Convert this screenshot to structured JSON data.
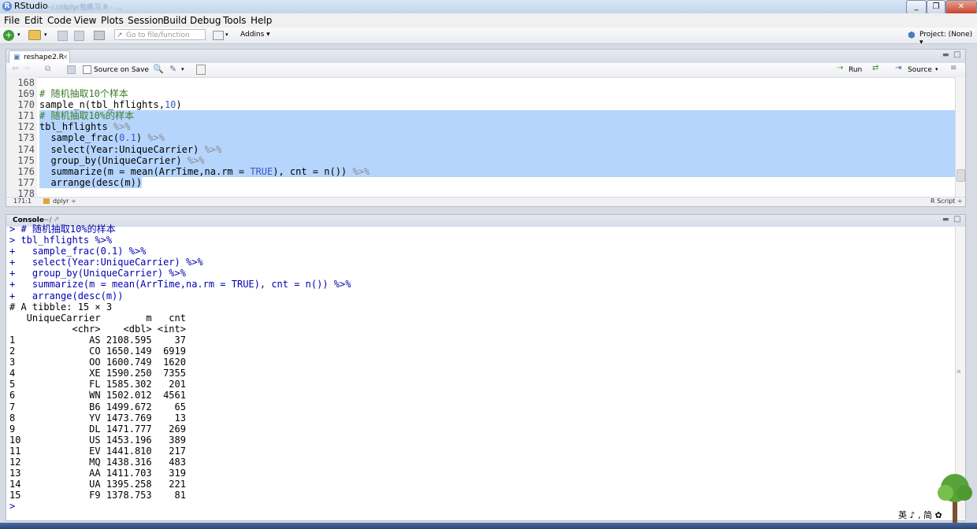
{
  "window": {
    "title": "RStudio",
    "title_blurred": "~/.r/dplyr包练习.R - ..."
  },
  "menu": [
    "File",
    "Edit",
    "Code",
    "View",
    "Plots",
    "Session",
    "Build",
    "Debug",
    "Tools",
    "Help"
  ],
  "toolbar": {
    "goto_placeholder": "Go to file/function",
    "addins_label": "Addins ▾",
    "project_label": "Project: (None) ▾"
  },
  "editor": {
    "tab_label": "reshape2.R",
    "source_on_save": "Source on Save",
    "run_label": "Run",
    "source_label": "Source",
    "line_numbers": [
      "168",
      "169",
      "170",
      "171",
      "172",
      "173",
      "174",
      "175",
      "176",
      "177",
      "178"
    ],
    "cursor_pos": "171:1",
    "scope": "dplyr ÷",
    "filetype": "R Script ÷",
    "lines": [
      {
        "parts": [
          {
            "t": ""
          }
        ]
      },
      {
        "parts": [
          {
            "t": "# 随机抽取10个样本",
            "c": "cm"
          }
        ]
      },
      {
        "parts": [
          {
            "t": "sample_n(tbl_hflights,"
          },
          {
            "t": "10",
            "c": "nm"
          },
          {
            "t": ")"
          }
        ]
      },
      {
        "parts": [
          {
            "t": "# 随机抽取10%的样本",
            "c": "cm"
          }
        ],
        "sel": true
      },
      {
        "parts": [
          {
            "t": "tbl_hflights "
          },
          {
            "t": "%>%",
            "c": "sp"
          }
        ],
        "sel": true
      },
      {
        "parts": [
          {
            "t": "  sample_frac("
          },
          {
            "t": "0.1",
            "c": "nm"
          },
          {
            "t": ") "
          },
          {
            "t": "%>%",
            "c": "sp"
          }
        ],
        "sel": true
      },
      {
        "parts": [
          {
            "t": "  select(Year:UniqueCarrier) "
          },
          {
            "t": "%>%",
            "c": "sp"
          }
        ],
        "sel": true
      },
      {
        "parts": [
          {
            "t": "  group_by(UniqueCarrier) "
          },
          {
            "t": "%>%",
            "c": "sp"
          }
        ],
        "sel": true
      },
      {
        "parts": [
          {
            "t": "  summarize(m = mean(ArrTime,na.rm = "
          },
          {
            "t": "TRUE",
            "c": "bool"
          },
          {
            "t": "), cnt = n()) "
          },
          {
            "t": "%>%",
            "c": "sp"
          }
        ],
        "sel": true
      },
      {
        "parts": [
          {
            "t": "  arrange(desc(m))"
          }
        ],
        "sel": true,
        "partial": true
      },
      {
        "parts": [
          {
            "t": ""
          }
        ]
      }
    ]
  },
  "console": {
    "title": "Console",
    "path": "~/",
    "input_lines": [
      "> # 随机抽取10%的样本",
      "> tbl_hflights %>%",
      "+   sample_frac(0.1) %>%",
      "+   select(Year:UniqueCarrier) %>%",
      "+   group_by(UniqueCarrier) %>%",
      "+   summarize(m = mean(ArrTime,na.rm = TRUE), cnt = n()) %>%",
      "+   arrange(desc(m))"
    ],
    "output_lines": [
      "# A tibble: 15 × 3",
      "   UniqueCarrier        m   cnt",
      "           <chr>    <dbl> <int>",
      "1             AS 2108.595    37",
      "2             CO 1650.149  6919",
      "3             OO 1600.749  1620",
      "4             XE 1590.250  7355",
      "5             FL 1585.302   201",
      "6             WN 1502.012  4561",
      "7             B6 1499.672    65",
      "8             YV 1473.769    13",
      "9             DL 1471.777   269",
      "10            US 1453.196   389",
      "11            EV 1441.810   217",
      "12            MQ 1438.316   483",
      "13            AA 1411.703   319",
      "14            UA 1395.258   221",
      "15            F9 1378.753    81"
    ],
    "prompt": ">"
  },
  "ime": {
    "label": "英 ♪ , 简 ✿"
  },
  "colors": {
    "selection": "#b6d5fd",
    "comment": "#3d7d2e",
    "number": "#3e58c0",
    "console_input": "#0000b0"
  }
}
